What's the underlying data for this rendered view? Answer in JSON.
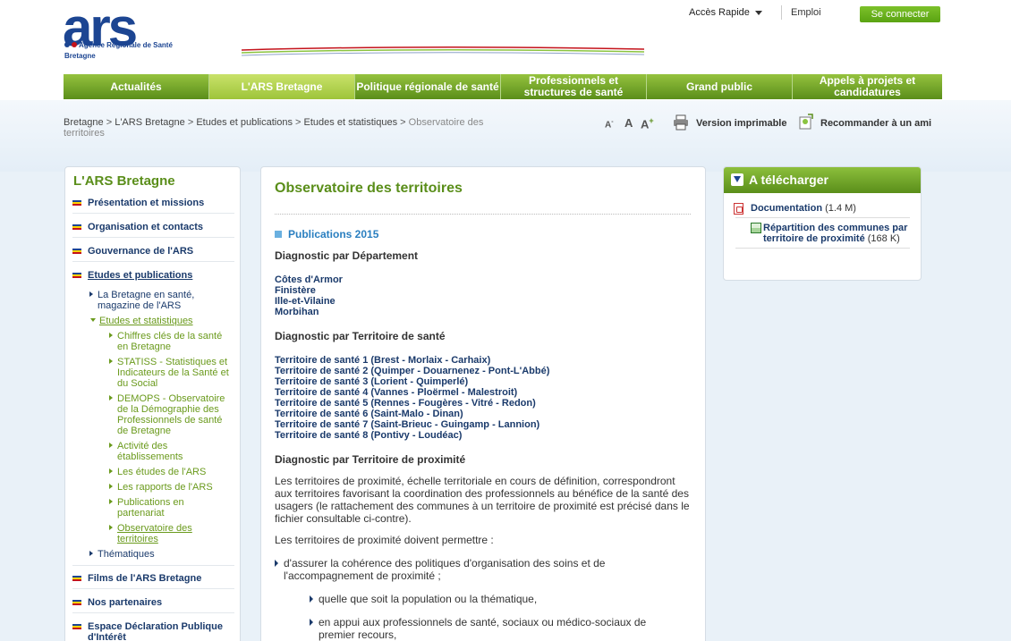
{
  "logo": {
    "brand": "ars",
    "agency": "Agence Régionale de Santé",
    "region": "Bretagne"
  },
  "top": {
    "acces_rapide": "Accès Rapide",
    "emploi": "Emploi",
    "connect": "Se connecter"
  },
  "nav": [
    {
      "label": "Actualités"
    },
    {
      "label": "L'ARS Bretagne"
    },
    {
      "label": "Politique régionale de santé"
    },
    {
      "label": "Professionnels et structures de santé"
    },
    {
      "label": "Grand public"
    },
    {
      "label": "Appels à projets et candidatures"
    }
  ],
  "breadcrumb": {
    "c1": "Bretagne",
    "c2": "L'ARS Bretagne",
    "c3": "Etudes et publications",
    "c4": "Etudes et statistiques",
    "current": "Observatoire des territoires",
    "sep": ">"
  },
  "tools": {
    "font_small": "A",
    "font_normal": "A",
    "font_large": "A",
    "print": "Version imprimable",
    "recommend": "Recommander à un ami"
  },
  "sidebar": {
    "title": "L'ARS Bretagne",
    "items": [
      "Présentation et missions",
      "Organisation et contacts",
      "Gouvernance de l'ARS",
      "Etudes et publications",
      "Films de l'ARS Bretagne",
      "Nos partenaires",
      "Espace Déclaration Publique d'Intérêt"
    ],
    "sub": {
      "bretagne_sante": "La Bretagne en santé, magazine de l'ARS",
      "etudes_stats": "Etudes et statistiques",
      "thematiques": "Thématiques"
    },
    "subsub": [
      "Chiffres clés de la santé en Bretagne",
      "STATISS - Statistiques et Indicateurs de la Santé et du Social",
      "DEMOPS - Observatoire de la Démographie des Professionnels de santé de Bretagne",
      "Activité des établissements",
      "Les études de l'ARS",
      "Les rapports de l'ARS",
      "Publications en partenariat",
      "Observatoire des territoires"
    ]
  },
  "content": {
    "title": "Observatoire des territoires",
    "pub_head": "Publications 2015",
    "sec1": "Diagnostic par Département",
    "departements": [
      "Côtes d'Armor",
      "Finistère",
      "Ille-et-Vilaine",
      "Morbihan"
    ],
    "sec2": "Diagnostic par Territoire de santé",
    "territoires": [
      "Territoire de santé 1 (Brest - Morlaix - Carhaix)",
      "Territoire de santé 2 (Quimper - Douarnenez - Pont-L'Abbé)",
      "Territoire de santé 3 (Lorient - Quimperlé)",
      "Territoire de santé 4 (Vannes - Ploërmel - Malestroit)",
      "Territoire de santé 5 (Rennes - Fougères - Vitré - Redon)",
      "Territoire de santé 6 (Saint-Malo - Dinan)",
      "Territoire de santé 7 (Saint-Brieuc - Guingamp - Lannion)",
      "Territoire de santé 8 (Pontivy - Loudéac)"
    ],
    "sec3": "Diagnostic par Territoire de proximité",
    "para1": "Les territoires de proximité, échelle territoriale en cours de définition, correspondront aux territoires favorisant la coordination des professionnels au bénéfice de la santé des usagers (le rattachement des communes à un territoire de proximité est précisé dans le fichier consultable ci-contre).",
    "para2": "Les territoires de proximité doivent permettre :",
    "b1": "d'assurer la cohérence des politiques d'organisation des soins et de l'accompagnement de proximité ;",
    "b2": "quelle que soit la population ou la thématique,",
    "b3": "en appui aux professionnels de santé, sociaux ou médico-sociaux de premier recours,"
  },
  "download": {
    "title": "A télécharger",
    "doc_name": "Documentation",
    "doc_size": "(1.4 M)",
    "rep_name": "Répartition des communes par territoire de proximité",
    "rep_size": "(168 K)"
  },
  "colors": {
    "green": "#5a8e1a",
    "blue": "#1a3a6b",
    "accent_blue": "#2a7fc0"
  }
}
